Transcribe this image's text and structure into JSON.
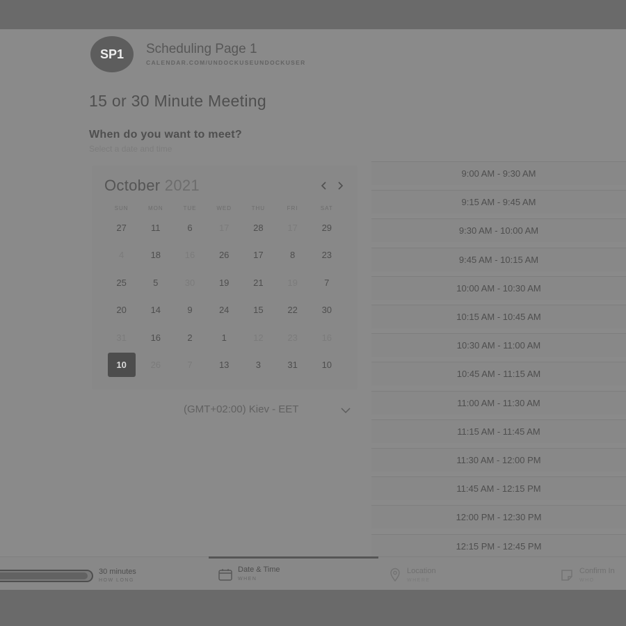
{
  "header": {
    "avatar_text": "SP1",
    "page_title": "Scheduling Page 1",
    "page_url": "CALENDAR.COM/UNDOCKUSEUNDOCKUSER"
  },
  "meeting_title": "15 or 30 Minute Meeting",
  "prompt": {
    "question": "When do you want to meet?",
    "hint": "Select a date and time"
  },
  "calendar": {
    "month": "October",
    "year": "2021",
    "prev_icon": "chevron-left-icon",
    "next_icon": "chevron-right-icon",
    "weekdays": [
      "SUN",
      "MON",
      "TUE",
      "WED",
      "THU",
      "FRI",
      "SAT"
    ],
    "weeks": [
      [
        {
          "d": "27"
        },
        {
          "d": "11"
        },
        {
          "d": "6"
        },
        {
          "d": "17",
          "muted": true
        },
        {
          "d": "28"
        },
        {
          "d": "17",
          "muted": true
        },
        {
          "d": "29"
        }
      ],
      [
        {
          "d": "4",
          "muted": true
        },
        {
          "d": "18"
        },
        {
          "d": "16",
          "muted": true
        },
        {
          "d": "26"
        },
        {
          "d": "17"
        },
        {
          "d": "8"
        },
        {
          "d": "23"
        }
      ],
      [
        {
          "d": "25"
        },
        {
          "d": "5"
        },
        {
          "d": "30",
          "muted": true
        },
        {
          "d": "19"
        },
        {
          "d": "21"
        },
        {
          "d": "19",
          "muted": true
        },
        {
          "d": "7"
        }
      ],
      [
        {
          "d": "20"
        },
        {
          "d": "14"
        },
        {
          "d": "9"
        },
        {
          "d": "24"
        },
        {
          "d": "15"
        },
        {
          "d": "22"
        },
        {
          "d": "30"
        }
      ],
      [
        {
          "d": "31",
          "muted": true
        },
        {
          "d": "16"
        },
        {
          "d": "2"
        },
        {
          "d": "1"
        },
        {
          "d": "12",
          "muted": true
        },
        {
          "d": "23",
          "muted": true
        },
        {
          "d": "16",
          "muted": true
        }
      ],
      [
        {
          "d": "10",
          "selected": true
        },
        {
          "d": "26",
          "muted": true
        },
        {
          "d": "7",
          "muted": true
        },
        {
          "d": "13"
        },
        {
          "d": "3"
        },
        {
          "d": "31"
        },
        {
          "d": "10"
        }
      ]
    ]
  },
  "timezone": {
    "label": "(GMT+02:00) Kiev - EET",
    "icon": "chevron-down-icon"
  },
  "time_slots": [
    "9:00 AM - 9:30 AM",
    "9:15 AM - 9:45 AM",
    "9:30 AM - 10:00 AM",
    "9:45 AM - 10:15 AM",
    "10:00 AM - 10:30 AM",
    "10:15 AM - 10:45 AM",
    "10:30 AM - 11:00 AM",
    "10:45 AM - 11:15 AM",
    "11:00 AM - 11:30 AM",
    "11:15 AM - 11:45 AM",
    "11:30 AM - 12:00 PM",
    "11:45 AM - 12:15 PM",
    "12:00 PM - 12:30 PM",
    "12:15 PM - 12:45 PM"
  ],
  "steps": {
    "progress": 0.97,
    "duration": {
      "title": "30 minutes",
      "sub": "HOW LONG"
    },
    "datetime": {
      "title": "Date & Time",
      "sub": "WHEN",
      "icon": "calendar-icon"
    },
    "location": {
      "title": "Location",
      "sub": "WHERE",
      "icon": "location-pin-icon"
    },
    "confirm": {
      "title": "Confirm In",
      "sub": "WHO",
      "icon": "note-icon"
    }
  }
}
